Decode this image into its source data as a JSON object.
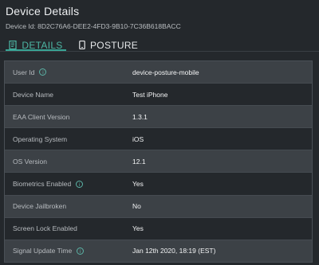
{
  "header": {
    "title": "Device Details",
    "device_id_label": "Device Id:",
    "device_id_value": "8D2C76A6-DEE2-4FD3-9B10-7C36B618BACC"
  },
  "tabs": [
    {
      "label": "DETAILS",
      "icon": "document-icon",
      "active": true
    },
    {
      "label": "POSTURE",
      "icon": "mobile-icon",
      "active": false
    }
  ],
  "colors": {
    "accent": "#38a596",
    "background": "#24282c",
    "row_alt": "#3c4146"
  },
  "details": [
    {
      "label": "User Id",
      "value": "device-posture-mobile",
      "info": true
    },
    {
      "label": "Device Name",
      "value": "Test iPhone",
      "info": false
    },
    {
      "label": "EAA Client Version",
      "value": "1.3.1",
      "info": false
    },
    {
      "label": "Operating System",
      "value": "iOS",
      "info": false
    },
    {
      "label": "OS Version",
      "value": "12.1",
      "info": false
    },
    {
      "label": "Biometrics Enabled",
      "value": "Yes",
      "info": true
    },
    {
      "label": "Device Jailbroken",
      "value": "No",
      "info": false
    },
    {
      "label": "Screen Lock Enabled",
      "value": "Yes",
      "info": false
    },
    {
      "label": "Signal Update Time",
      "value": "Jan 12th 2020, 18:19 (EST)",
      "info": true
    }
  ]
}
